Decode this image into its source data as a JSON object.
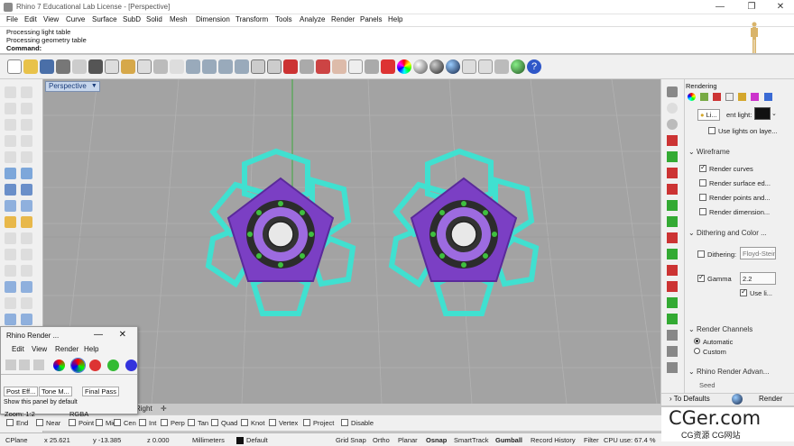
{
  "window": {
    "title": "Rhino 7 Educational Lab License - [Perspective]",
    "min": "—",
    "max": "❐",
    "close": "✕"
  },
  "menu": [
    "File",
    "Edit",
    "View",
    "Curve",
    "Surface",
    "SubD",
    "Solid",
    "Mesh",
    "Dimension",
    "Transform",
    "Tools",
    "Analyze",
    "Render",
    "Panels",
    "Help"
  ],
  "command": {
    "history": [
      "Processing light table",
      "Processing geometry table"
    ],
    "prompt": "Command:"
  },
  "viewport": {
    "label": "Perspective"
  },
  "panel": {
    "title": "Rendering",
    "lights": {
      "label": "Li...",
      "suffix": "ent light:",
      "use_lights": "Use lights on laye..."
    },
    "wireframe": {
      "header": "Wireframe",
      "items": [
        "Render curves",
        "Render surface ed...",
        "Render points and...",
        "Render dimension..."
      ],
      "checked": [
        true,
        false,
        false,
        false
      ]
    },
    "dithering": {
      "header": "Dithering and Color ...",
      "label": "Dithering:",
      "value": "Floyd-Stein",
      "gamma_label": "Gamma",
      "gamma_value": "2.2",
      "use_linear": "Use li..."
    },
    "channels": {
      "header": "Render Channels",
      "automatic": "Automatic",
      "custom": "Custom"
    },
    "advanced": {
      "header": "Rhino Render Advan...",
      "seed": "Seed"
    },
    "to_defaults": "To Defaults",
    "render": "Render"
  },
  "render_window": {
    "title": "Rhino Render ...",
    "menu": [
      "Edit",
      "View",
      "Render",
      "Help"
    ],
    "tabs": [
      "Post Eff...",
      "Tone M...",
      "Final Pass"
    ],
    "hint": "Show this panel by default",
    "zoom": "Zoom: 1:2",
    "format": "RGBA",
    "minimize": "—",
    "close": "✕"
  },
  "osnaps": [
    "End",
    "Near",
    "Point",
    "Mid",
    "Cen",
    "Int",
    "Perp",
    "Tan",
    "Quad",
    "Knot",
    "Vertex",
    "Project",
    "Disable"
  ],
  "osnap_checked": [
    false,
    false,
    false,
    false,
    false,
    false,
    false,
    false,
    false,
    false,
    false,
    false,
    false
  ],
  "status": {
    "cplane": "CPlane",
    "x": "x 25.621",
    "y": "y -13.385",
    "z": "z 0.000",
    "units": "Millimeters",
    "layer": "Default",
    "grid_snap": "Grid Snap",
    "ortho": "Ortho",
    "planar": "Planar",
    "osnap": "Osnap",
    "smarttrack": "SmartTrack",
    "gumball": "Gumball",
    "record_history": "Record History",
    "filter": "Filter",
    "cpu": "CPU use: 67.4 %",
    "right_tab": "Right"
  },
  "watermark": {
    "brand": "CGer.com",
    "sub": "CG资源 CG网站"
  },
  "colors": {
    "accent": "#2a5caa",
    "mesh": "#40e0d0",
    "gem": "#7b3fc4",
    "viewport": "#a3a3a3"
  }
}
